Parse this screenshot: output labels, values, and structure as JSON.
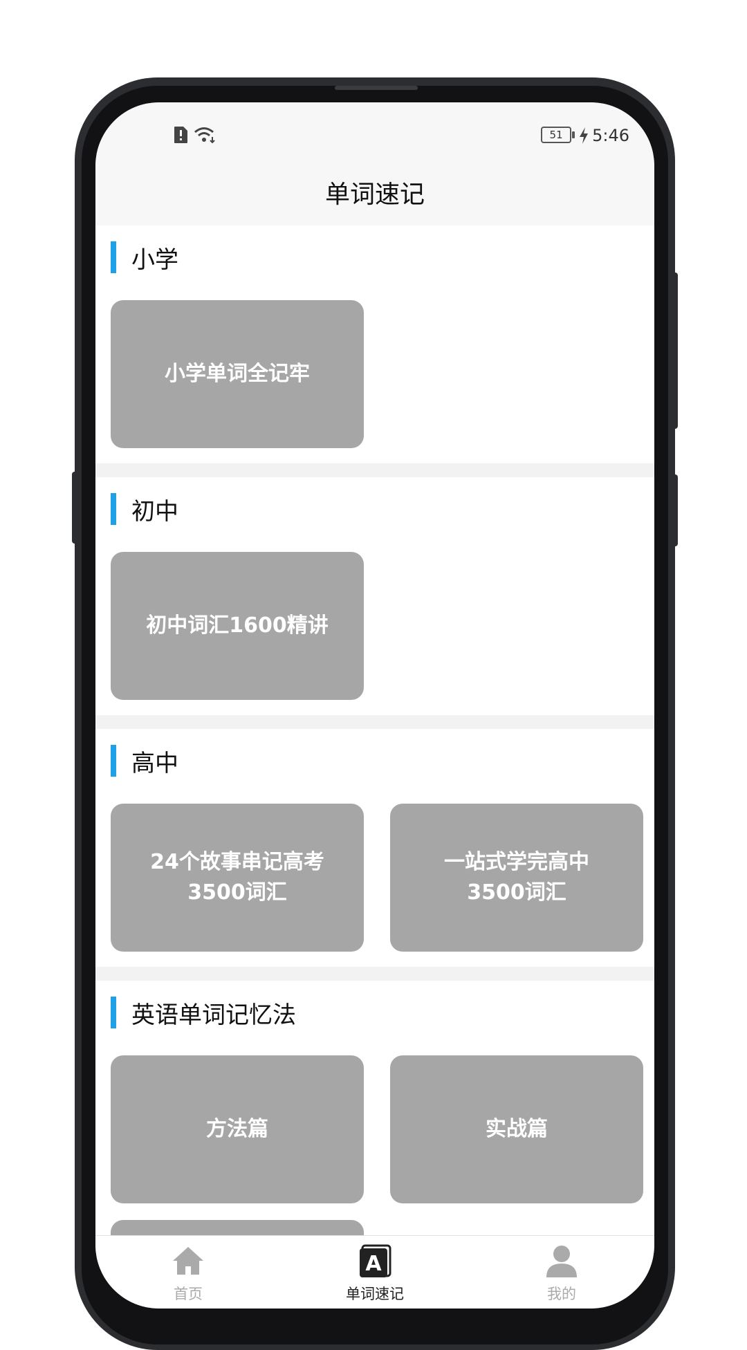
{
  "status_bar": {
    "time": "5:46",
    "battery": "51"
  },
  "header": {
    "title": "单词速记"
  },
  "sections": [
    {
      "title": "小学",
      "cards": [
        "小学单词全记牢"
      ]
    },
    {
      "title": "初中",
      "cards": [
        "初中词汇1600精讲"
      ]
    },
    {
      "title": "高中",
      "cards": [
        "24个故事串记高考3500词汇",
        "一站式学完高中3500词汇"
      ]
    },
    {
      "title": "英语单词记忆法",
      "cards": [
        "方法篇",
        "实战篇"
      ]
    }
  ],
  "bottom_nav": [
    {
      "label": "首页",
      "icon": "home-icon",
      "active": false
    },
    {
      "label": "单词速记",
      "icon": "letter-a-icon",
      "active": true
    },
    {
      "label": "我的",
      "icon": "user-icon",
      "active": false
    }
  ],
  "colors": {
    "accent": "#1ea1e6",
    "card": "#a6a6a6",
    "divider": "#f2f2f2"
  }
}
